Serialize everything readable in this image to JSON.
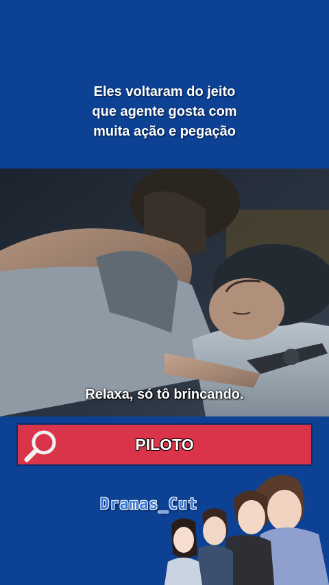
{
  "caption": {
    "lines": [
      "Eles voltaram do jeito",
      "que agente gosta com",
      "muita ação e pegação"
    ]
  },
  "video": {
    "subtitle": "Relaxa, só tô brincando."
  },
  "search": {
    "query": "PILOTO",
    "icon": "search-icon"
  },
  "brand": {
    "name": "Dramas_Cut"
  },
  "colors": {
    "background": "#0d4194",
    "search_bar": "#da344b",
    "brand_text": "#3a78d6"
  }
}
